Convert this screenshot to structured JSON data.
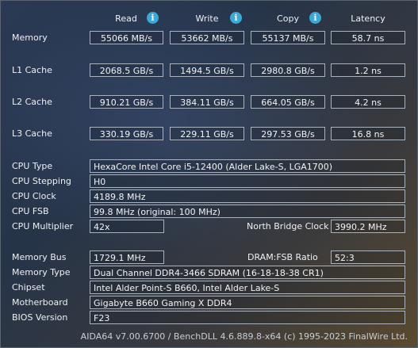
{
  "headers": {
    "read": "Read",
    "write": "Write",
    "copy": "Copy",
    "latency": "Latency"
  },
  "rows": {
    "memory": {
      "label": "Memory",
      "read": "55066 MB/s",
      "write": "53662 MB/s",
      "copy": "55137 MB/s",
      "latency": "58.7 ns"
    },
    "l1": {
      "label": "L1 Cache",
      "read": "2068.5 GB/s",
      "write": "1494.5 GB/s",
      "copy": "2980.8 GB/s",
      "latency": "1.2 ns"
    },
    "l2": {
      "label": "L2 Cache",
      "read": "910.21 GB/s",
      "write": "384.11 GB/s",
      "copy": "664.05 GB/s",
      "latency": "4.2 ns"
    },
    "l3": {
      "label": "L3 Cache",
      "read": "330.19 GB/s",
      "write": "229.11 GB/s",
      "copy": "297.53 GB/s",
      "latency": "16.8 ns"
    }
  },
  "cpu": {
    "type_label": "CPU Type",
    "type_value": "HexaCore Intel Core i5-12400  (Alder Lake-S, LGA1700)",
    "stepping_label": "CPU Stepping",
    "stepping_value": "H0",
    "clock_label": "CPU Clock",
    "clock_value": "4189.8 MHz",
    "fsb_label": "CPU FSB",
    "fsb_value": "99.8 MHz  (original: 100 MHz)",
    "multiplier_label": "CPU Multiplier",
    "multiplier_value": "42x",
    "nb_clock_label": "North Bridge Clock",
    "nb_clock_value": "3990.2 MHz"
  },
  "system": {
    "mem_bus_label": "Memory Bus",
    "mem_bus_value": "1729.1 MHz",
    "dram_fsb_label": "DRAM:FSB Ratio",
    "dram_fsb_value": "52:3",
    "mem_type_label": "Memory Type",
    "mem_type_value": "Dual Channel DDR4-3466 SDRAM  (16-18-18-38 CR1)",
    "chipset_label": "Chipset",
    "chipset_value": "Intel Alder Point-S B660, Intel Alder Lake-S",
    "motherboard_label": "Motherboard",
    "motherboard_value": "Gigabyte B660 Gaming X DDR4",
    "bios_label": "BIOS Version",
    "bios_value": "F23"
  },
  "footer": "AIDA64 v7.00.6700 / BenchDLL 4.6.889.8-x64  (c) 1995-2023 FinalWire Ltd.",
  "icons": {
    "info": "info-icon",
    "info_glyph": "i"
  },
  "colors": {
    "info_icon": "#3aa8d8",
    "box_border": "#a9b2bd"
  }
}
